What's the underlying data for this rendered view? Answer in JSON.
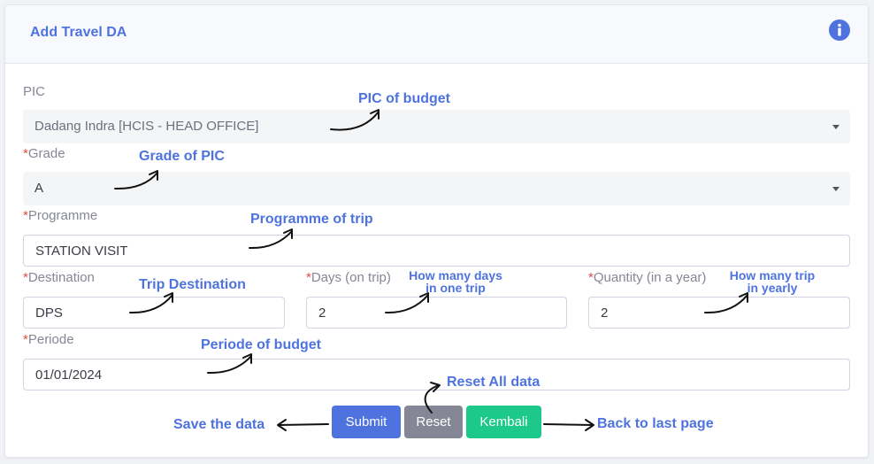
{
  "header": {
    "title": "Add Travel DA"
  },
  "form": {
    "pic": {
      "label": "PIC",
      "value": "Dadang Indra [HCIS - HEAD OFFICE]"
    },
    "grade": {
      "required_mark": "*",
      "label": "Grade",
      "value": "A"
    },
    "programme": {
      "required_mark": "*",
      "label": "Programme",
      "value": "STATION VISIT"
    },
    "destination": {
      "required_mark": "*",
      "label": "Destination",
      "value": "DPS"
    },
    "days": {
      "required_mark": "*",
      "label": "Days (on trip)",
      "value": "2"
    },
    "quantity": {
      "required_mark": "*",
      "label": "Quantity (in a year)",
      "value": "2"
    },
    "periode": {
      "required_mark": "*",
      "label": "Periode",
      "value": "01/01/2024"
    }
  },
  "buttons": {
    "submit": "Submit",
    "reset": "Reset",
    "back": "Kembali"
  },
  "annotations": {
    "pic": "PIC of budget",
    "grade": "Grade of PIC",
    "programme": "Programme of trip",
    "destination": "Trip Destination",
    "days_line1": "How many days",
    "days_line2": "in one trip",
    "quantity_line1": "How many trip",
    "quantity_line2": "in yearly",
    "periode": "Periode of budget",
    "reset": "Reset All data",
    "submit": "Save the data",
    "back": "Back to last page"
  },
  "colors": {
    "accent": "#4e73df",
    "required": "#e74a3b",
    "submit": "#4e73df",
    "reset": "#858796",
    "back": "#1cc88a"
  },
  "icons": {
    "info": "info-circle-icon",
    "dropdown": "chevron-down-icon"
  }
}
